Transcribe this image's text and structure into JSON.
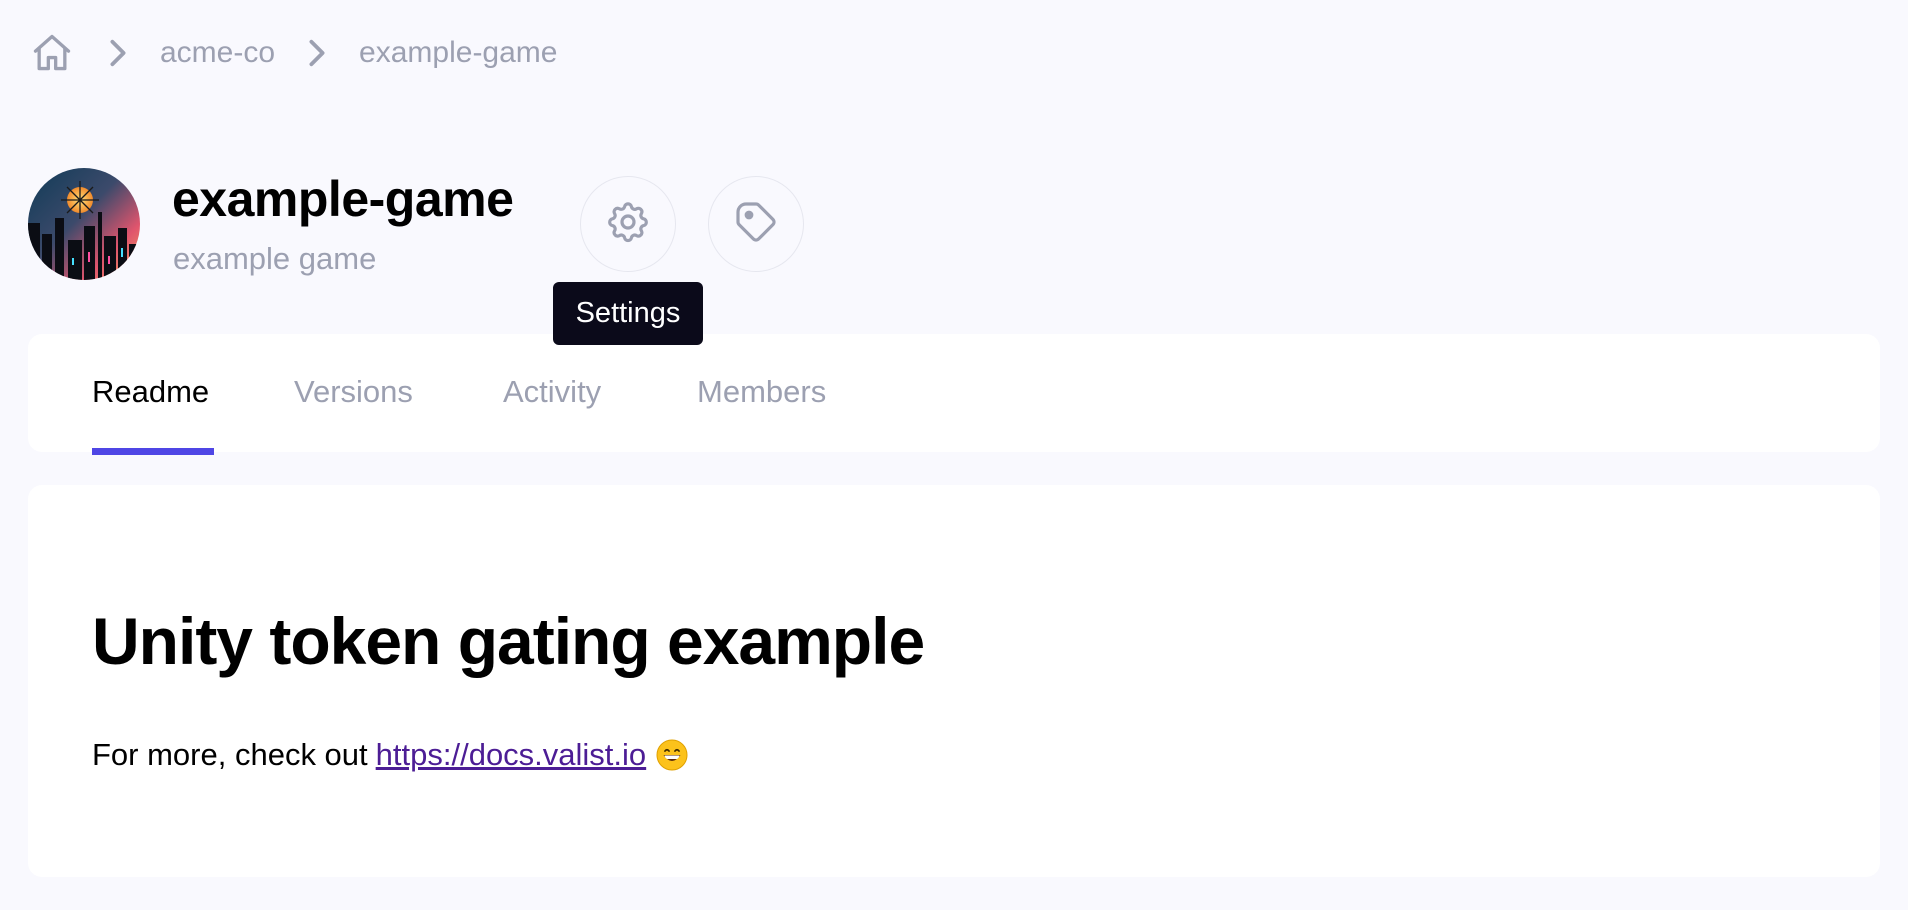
{
  "breadcrumb": {
    "home_icon": "home-icon",
    "separator_icon": "chevron-right-icon",
    "items": [
      {
        "label": "acme-co"
      },
      {
        "label": "example-game"
      }
    ]
  },
  "project": {
    "title": "example-game",
    "subtitle": "example game",
    "avatar_alt": "project avatar"
  },
  "actions": {
    "settings_icon": "gear-icon",
    "tag_icon": "tag-icon",
    "tooltip": "Settings"
  },
  "tabs": [
    {
      "label": "Readme",
      "active": true
    },
    {
      "label": "Versions",
      "active": false
    },
    {
      "label": "Activity",
      "active": false
    },
    {
      "label": "Members",
      "active": false
    }
  ],
  "readme": {
    "heading": "Unity token gating example",
    "text_prefix": "For more, check out",
    "link_text": "https://docs.valist.io",
    "emoji_icon": "grinning-face-icon"
  },
  "colors": {
    "accent": "#4f46e5",
    "muted_text": "#9ca0b1",
    "link": "#4c1d95",
    "tooltip_bg": "#0b0a1a",
    "page_bg": "#f9f9fe"
  }
}
